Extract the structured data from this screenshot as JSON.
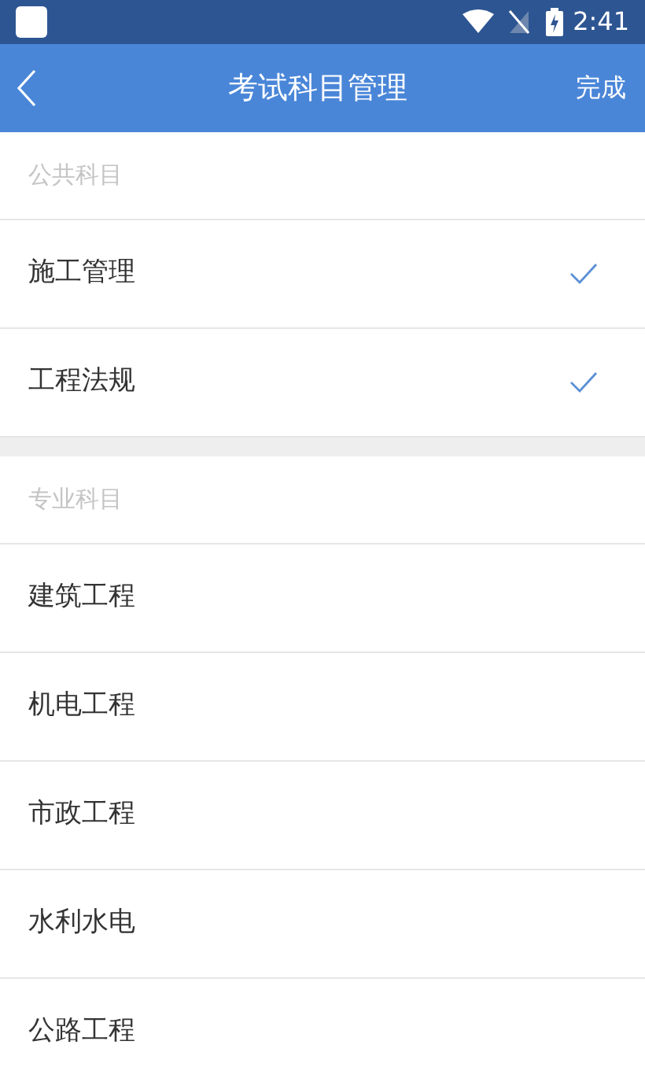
{
  "status_bar": {
    "time": "2:41"
  },
  "header": {
    "title": "考试科目管理",
    "action": "完成"
  },
  "sections": [
    {
      "title": "公共科目",
      "items": [
        {
          "label": "施工管理",
          "selected": true
        },
        {
          "label": "工程法规",
          "selected": true
        }
      ]
    },
    {
      "title": "专业科目",
      "items": [
        {
          "label": "建筑工程",
          "selected": false
        },
        {
          "label": "机电工程",
          "selected": false
        },
        {
          "label": "市政工程",
          "selected": false
        },
        {
          "label": "水利水电",
          "selected": false
        },
        {
          "label": "公路工程",
          "selected": false
        }
      ]
    }
  ]
}
